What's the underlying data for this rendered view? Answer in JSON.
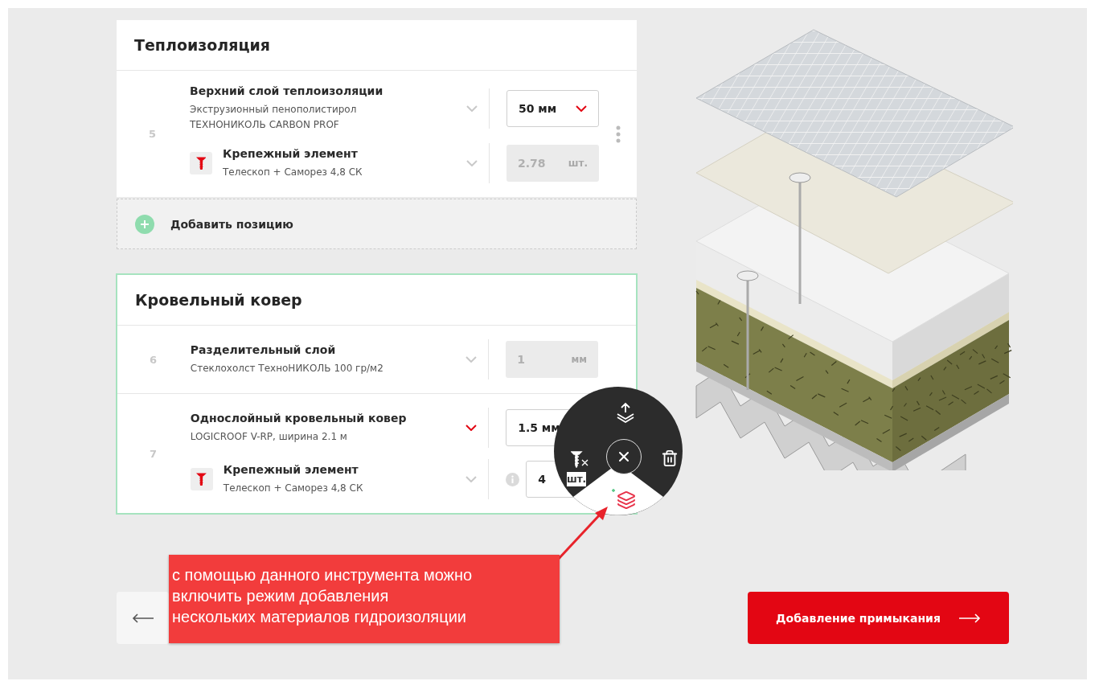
{
  "sections": [
    {
      "title": "Теплоизоляция",
      "highlighted": false,
      "add_label": "Добавить позицию",
      "rows": [
        {
          "number": "5",
          "menu": true,
          "items": [
            {
              "kind": "material",
              "title": "Верхний слой теплоизоляции",
              "subtitle": "Экструзионный пенополистирол ТЕХНОНИКОЛЬ CARBON PROF",
              "active": false,
              "info": false,
              "field": {
                "kind": "select",
                "value": "50 мм"
              }
            },
            {
              "kind": "fastener",
              "title": "Крепежный элемент",
              "subtitle": "Телескоп + Саморез 4,8 СК",
              "active": false,
              "info": false,
              "field": {
                "kind": "readonly",
                "value": "2.78",
                "unit": "шт."
              }
            }
          ]
        }
      ]
    },
    {
      "title": "Кровельный ковер",
      "highlighted": true,
      "rows": [
        {
          "number": "6",
          "menu": false,
          "items": [
            {
              "kind": "material",
              "title": "Разделительный слой",
              "subtitle": "Стеклохолст ТехноНИКОЛЬ 100 гр/м2",
              "active": false,
              "info": false,
              "field": {
                "kind": "readonly",
                "value": "1",
                "unit": "мм"
              }
            }
          ]
        },
        {
          "number": "7",
          "menu": false,
          "items": [
            {
              "kind": "material",
              "title": "Однослойный кровельный ковер",
              "subtitle": "LOGICROOF V-RP, ширина 2.1 м",
              "active": true,
              "info": false,
              "field": {
                "kind": "select",
                "value": "1.5 мм"
              }
            },
            {
              "kind": "fastener",
              "title": "Крепежный элемент",
              "subtitle": "Телескоп + Саморез 4,8 СК",
              "active": false,
              "info": true,
              "field": {
                "kind": "input",
                "value": "4",
                "unit": "шт."
              }
            }
          ]
        }
      ]
    }
  ],
  "callout": {
    "text": "с помощью данного инструмента можно\nвключить режим добавления\nнескольких материалов гидроизоляции"
  },
  "next_button": {
    "label": "Добавление примыкания"
  }
}
